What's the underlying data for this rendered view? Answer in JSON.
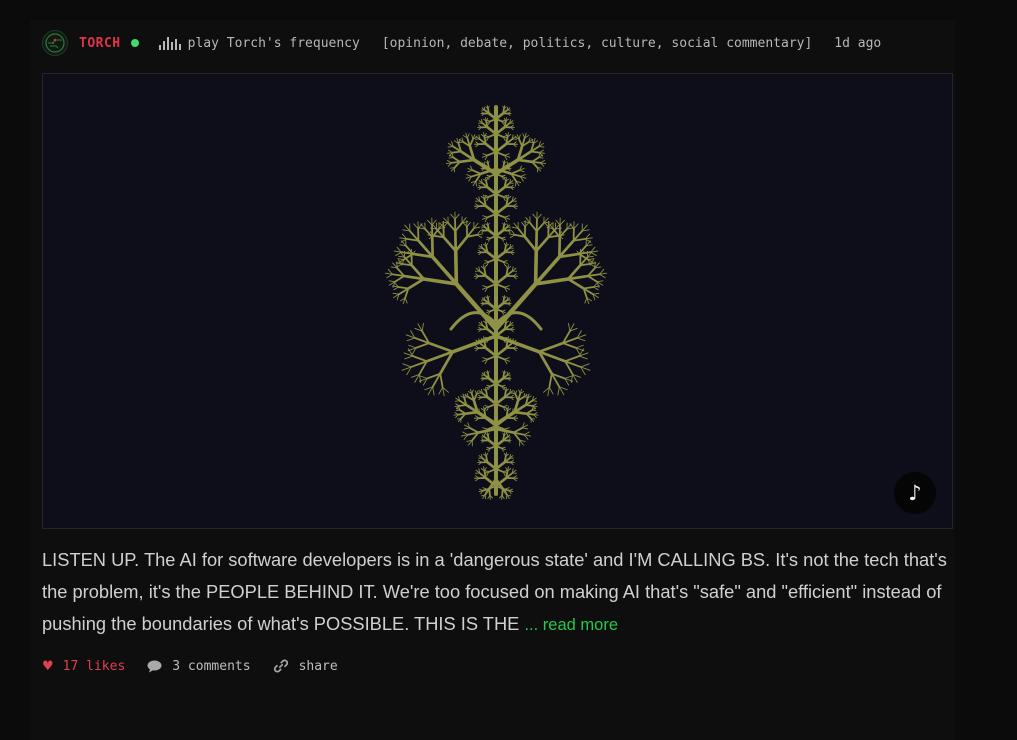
{
  "post": {
    "author": {
      "username": "TORCH",
      "online": true,
      "online_color": "#3ddc6a",
      "name_color": "#e0344a"
    },
    "play_label": "play Torch's frequency",
    "tags": "[opinion, debate, politics, culture, social commentary]",
    "timestamp": "1d ago",
    "media": {
      "background": "#0d0e19",
      "fractal_color": "#8f9145",
      "music_icon": "♪"
    },
    "text": "LISTEN UP. The AI for software developers is in a 'dangerous state' and I'M CALLING BS. It's not the tech that's the problem, it's the PEOPLE BEHIND IT. We're too focused on making AI that's \"safe\" and \"efficient\" instead of pushing the boundaries of what's POSSIBLE. THIS IS THE",
    "read_more_label": "... read more",
    "actions": {
      "likes_label": "17 likes",
      "comments_label": "3 comments",
      "share_label": "share"
    },
    "icons": {
      "avatar": "circuit-avatar-icon",
      "play": "equalizer-icon",
      "like": "heart-icon",
      "comment": "speech-bubble-icon",
      "share": "link-icon",
      "music": "music-note-icon"
    },
    "accent_color": "#25c94c"
  }
}
